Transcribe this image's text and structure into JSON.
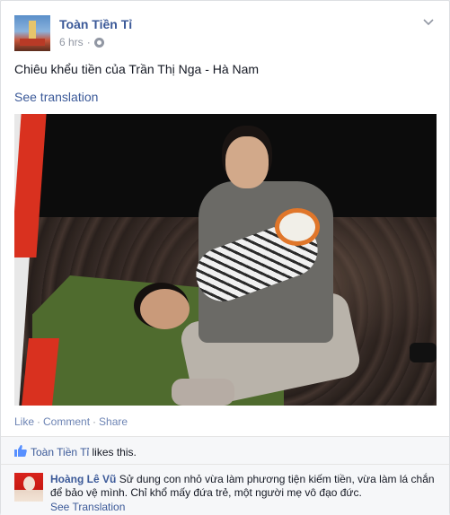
{
  "post": {
    "author": "Toàn Tiền Tỉ",
    "time": "6 hrs",
    "text": "Chiêu khểu tiền của Trần Thị Nga - Hà Nam",
    "see_translation": "See translation"
  },
  "actions": {
    "like": "Like",
    "comment": "Comment",
    "share": "Share",
    "separator": "·"
  },
  "likes": {
    "name": "Toàn Tiền Tỉ",
    "suffix": " likes this."
  },
  "comment": {
    "author": "Hoàng Lê Vũ",
    "text": "Sử dung con nhỏ vừa làm phương tiện kiếm tiền, vừa làm lá chắn để bảo vệ mình. Chỉ khổ mấy đứa trẻ, một người mẹ vô đạo đức.",
    "see_translation": "See Translation"
  },
  "colors": {
    "link": "#3b5998",
    "action_link": "#6d84b4",
    "meta": "#9197a3",
    "background": "#f6f7f9"
  },
  "icons": {
    "privacy": "globe-icon",
    "menu": "chevron-down-icon",
    "like": "thumbs-up-icon"
  }
}
